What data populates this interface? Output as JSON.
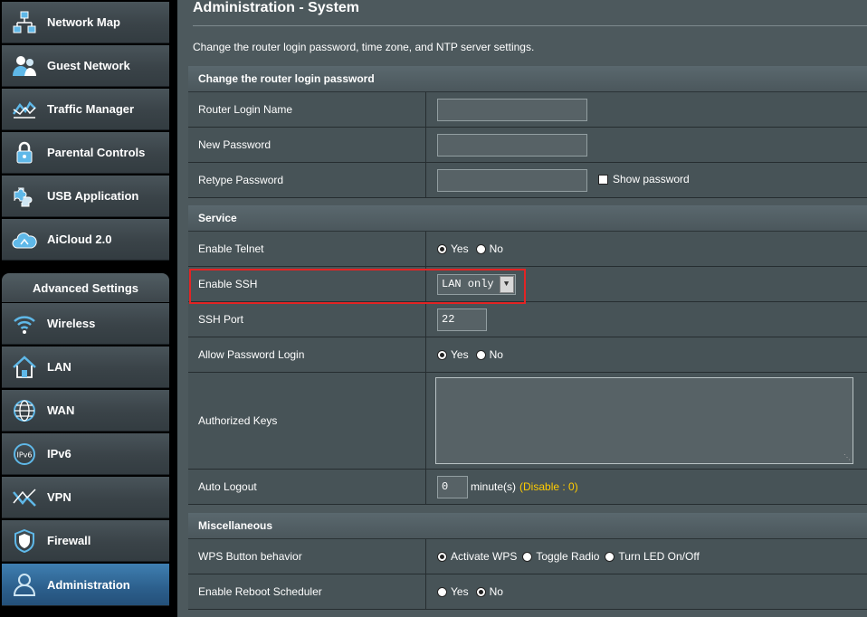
{
  "sidebar": {
    "general": [
      {
        "label": "Network Map",
        "icon": "network-map-icon"
      },
      {
        "label": "Guest Network",
        "icon": "guest-network-icon"
      },
      {
        "label": "Traffic Manager",
        "icon": "traffic-manager-icon"
      },
      {
        "label": "Parental Controls",
        "icon": "parental-controls-icon"
      },
      {
        "label": "USB Application",
        "icon": "usb-application-icon"
      },
      {
        "label": "AiCloud 2.0",
        "icon": "aicloud-icon"
      }
    ],
    "advanced_title": "Advanced Settings",
    "advanced": [
      {
        "label": "Wireless",
        "icon": "wireless-icon"
      },
      {
        "label": "LAN",
        "icon": "lan-icon"
      },
      {
        "label": "WAN",
        "icon": "wan-icon"
      },
      {
        "label": "IPv6",
        "icon": "ipv6-icon"
      },
      {
        "label": "VPN",
        "icon": "vpn-icon"
      },
      {
        "label": "Firewall",
        "icon": "firewall-icon"
      },
      {
        "label": "Administration",
        "icon": "administration-icon",
        "active": true
      }
    ]
  },
  "page": {
    "title": "Administration - System",
    "description": "Change the router login password, time zone, and NTP server settings."
  },
  "login_section": {
    "title": "Change the router login password",
    "login_name_label": "Router Login Name",
    "login_name_value": "",
    "new_password_label": "New Password",
    "retype_password_label": "Retype Password",
    "show_password_label": "Show password"
  },
  "service_section": {
    "title": "Service",
    "telnet_label": "Enable Telnet",
    "telnet_yes": "Yes",
    "telnet_no": "No",
    "ssh_label": "Enable SSH",
    "ssh_value": "LAN only",
    "ssh_port_label": "SSH Port",
    "ssh_port_value": "22",
    "pw_login_label": "Allow Password Login",
    "pw_login_yes": "Yes",
    "pw_login_no": "No",
    "auth_keys_label": "Authorized Keys",
    "auto_logout_label": "Auto Logout",
    "auto_logout_value": "0",
    "auto_logout_unit": "minute(s)",
    "auto_logout_hint": "(Disable : 0)"
  },
  "misc_section": {
    "title": "Miscellaneous",
    "wps_label": "WPS Button behavior",
    "wps_opt1": "Activate WPS",
    "wps_opt2": "Toggle Radio",
    "wps_opt3": "Turn LED On/Off",
    "reboot_label": "Enable Reboot Scheduler",
    "reboot_yes": "Yes",
    "reboot_no": "No"
  },
  "colors": {
    "active_nav": "#2c5f8c",
    "highlight_border": "#e32424",
    "hint": "#ffcc00"
  }
}
